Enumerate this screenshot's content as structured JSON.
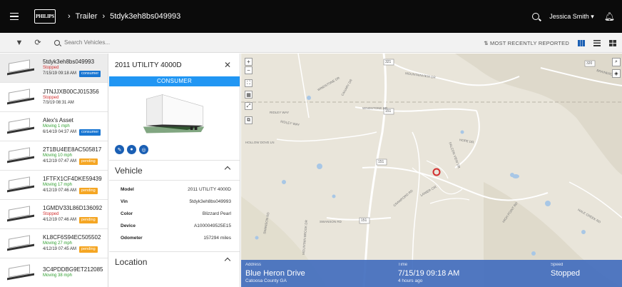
{
  "header": {
    "brand": "PHILIPS",
    "crumbs": [
      "Trailer",
      "5tdyk3eh8bs049993"
    ],
    "user": "Jessica Smith ▾"
  },
  "toolbar": {
    "search_placeholder": "Search Vehicles...",
    "sort_label": "MOST RECENTLY REPORTED"
  },
  "vehicles": [
    {
      "name": "5tdyk3eh8bs049993",
      "status": "Stopped",
      "status_kind": "stopped",
      "time": "7/15/19 09:18 AM",
      "badge": "consumer"
    },
    {
      "name": "JTNJJXB00CJ015356",
      "status": "Stopped",
      "status_kind": "stopped",
      "time": "7/3/19 08:31 AM",
      "badge": ""
    },
    {
      "name": "Alex's Asset",
      "status": "Moving 1 mph",
      "status_kind": "moving",
      "time": "6/14/19 04:37 AM",
      "badge": "consumer"
    },
    {
      "name": "2T1BU4EE8AC505817",
      "status": "Moving 10 mph",
      "status_kind": "moving",
      "time": "4/12/19 07:47 AM",
      "badge": "pending"
    },
    {
      "name": "1FTFX1CF4DKE59439",
      "status": "Moving 17 mph",
      "status_kind": "moving",
      "time": "4/12/19 07:46 AM",
      "badge": "pending"
    },
    {
      "name": "1GMDV33L86D136092",
      "status": "Stopped",
      "status_kind": "stopped",
      "time": "4/12/19 07:46 AM",
      "badge": "pending"
    },
    {
      "name": "KL8CF6S94EC505502",
      "status": "Moving 27 mph",
      "status_kind": "moving",
      "time": "4/12/19 07:45 AM",
      "badge": "pending"
    },
    {
      "name": "3C4PDDBG9ET212085",
      "status": "Moving 38 mph",
      "status_kind": "moving",
      "time": "",
      "badge": ""
    }
  ],
  "detail": {
    "title": "2011 UTILITY 4000D",
    "banner": "CONSUMER",
    "vehicle_section": "Vehicle",
    "rows": [
      {
        "k": "Model",
        "v": "2011 UTILITY 4000D"
      },
      {
        "k": "Vin",
        "v": "5tdyk3eh8bs049993"
      },
      {
        "k": "Color",
        "v": "Blizzard Pearl"
      },
      {
        "k": "Device",
        "v": "A1000049525E15"
      },
      {
        "k": "Odometer",
        "v": "157294 miles"
      }
    ],
    "location_section": "Location"
  },
  "map": {
    "roads": [
      "321",
      "151",
      "151",
      "151",
      "320",
      "MOUNTAINVIEW DR",
      "WINDSTONE DR",
      "WINDSTONE DR",
      "RIDLEY WAY",
      "RIDLEY WAY",
      "CANARY DR",
      "SWANSON RD",
      "SWANSON RD",
      "MOUNTAIN BROOK DR",
      "CRAWFORD RD",
      "LANIER CIR",
      "FALCON VIEW DR",
      "HOLLOW DOVE LN",
      "HALE CREEK RD",
      "HIGH POINT RD",
      "HOPE DR",
      "BRAINERD RD"
    ]
  },
  "info": {
    "address_label": "Address",
    "address": "Blue Heron Drive",
    "address_sub": "Catoosa County GA",
    "time_label": "Time",
    "time": "7/15/19 09:18 AM",
    "time_sub": "4 hours ago",
    "speed_label": "Speed",
    "speed": "Stopped"
  }
}
